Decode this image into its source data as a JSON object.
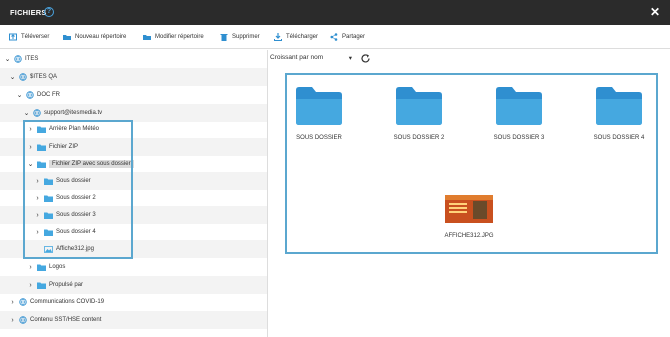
{
  "titlebar": {
    "title": "FICHIERS",
    "help": "?",
    "close": "✕"
  },
  "toolbar": {
    "upload": "Téléverser",
    "new_folder": "Nouveau répertoire",
    "edit_folder": "Modifier répertoire",
    "delete": "Supprimer",
    "download": "Télécharger",
    "share": "Partager"
  },
  "tree": {
    "ites": "ITES",
    "sites_qa": "$ITES QA",
    "doc_fr": "DOC FR",
    "support": "support@itesmedia.tv",
    "arriere_plan": "Arrière Plan Météo",
    "fichier_zip": "Fichier ZIP",
    "fichier_zip_sous": "Fichier ZIP avec sous dossier",
    "sous_dossier": "Sous dossier",
    "sous_dossier_2": "Sous dossier 2",
    "sous_dossier_3": "Sous dossier 3",
    "sous_dossier_4": "Sous dossier 4",
    "affiche": "Affiche312.jpg",
    "logos": "Logos",
    "propulse": "Propulsé par",
    "communications": "Communications COVID-19",
    "contenu": "Contenu SST/HSE content"
  },
  "sort": {
    "value": "Croissant par nom",
    "arrow": "▾"
  },
  "grid": {
    "items": [
      {
        "label": "SOUS DOSSIER"
      },
      {
        "label": "SOUS DOSSIER 2"
      },
      {
        "label": "SOUS DOSSIER 3"
      },
      {
        "label": "SOUS DOSSIER 4"
      },
      {
        "label": "AFFICHE312.JPG"
      }
    ]
  },
  "colors": {
    "folder": "#45a8e0",
    "selection": "#5ba7cf",
    "titlebar": "#2b2b2b"
  }
}
